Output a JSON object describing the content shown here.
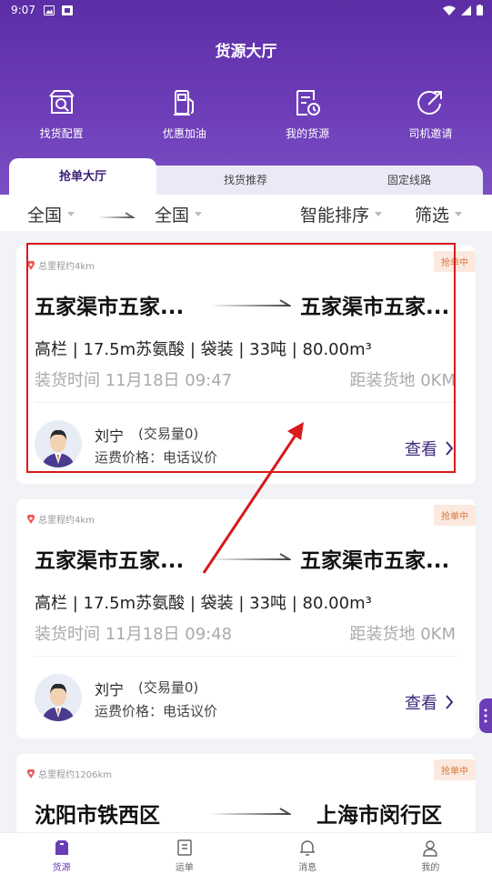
{
  "status": {
    "time": "9:07"
  },
  "header": {
    "title": "货源大厅"
  },
  "quick_actions": [
    {
      "label": "找货配置",
      "icon": "search-doc-icon"
    },
    {
      "label": "优惠加油",
      "icon": "fuel-pump-icon"
    },
    {
      "label": "我的货源",
      "icon": "cargo-list-icon"
    },
    {
      "label": "司机邀请",
      "icon": "share-arrow-icon"
    }
  ],
  "tabs": [
    {
      "label": "抢单大厅",
      "active": true
    },
    {
      "label": "找货推荐",
      "active": false
    },
    {
      "label": "固定线路",
      "active": false
    }
  ],
  "filters": {
    "origin": "全国",
    "destination": "全国",
    "sort": "智能排序",
    "filter": "筛选"
  },
  "cards": [
    {
      "distance": "总里程约4km",
      "badge": "抢单中",
      "from": "五家渠市五家...",
      "to": "五家渠市五家...",
      "specs": "高栏 | 17.5m苏氨酸 | 袋装 | 33吨 | 80.00m³",
      "load_time": "装货时间 11月18日 09:47",
      "load_distance": "距装货地 0KM",
      "driver": "刘宁",
      "trades": "(交易量0)",
      "price": "运费价格：电话议价",
      "view": "查看"
    },
    {
      "distance": "总里程约4km",
      "badge": "抢单中",
      "from": "五家渠市五家...",
      "to": "五家渠市五家...",
      "specs": "高栏 | 17.5m苏氨酸 | 袋装 | 33吨 | 80.00m³",
      "load_time": "装货时间 11月18日 09:48",
      "load_distance": "距装货地 0KM",
      "driver": "刘宁",
      "trades": "(交易量0)",
      "price": "运费价格：电话议价",
      "view": "查看"
    },
    {
      "distance": "总里程约1206km",
      "badge": "抢单中",
      "from": "沈阳市铁西区",
      "to": "上海市闵行区"
    }
  ],
  "bottom_nav": [
    {
      "label": "货源",
      "active": true
    },
    {
      "label": "运单",
      "active": false
    },
    {
      "label": "消息",
      "active": false
    },
    {
      "label": "我的",
      "active": false
    }
  ],
  "colors": {
    "brand": "#6b3db6",
    "badge_bg": "#fbe9df",
    "badge_text": "#d7783b",
    "annotation": "#d91a1a"
  }
}
